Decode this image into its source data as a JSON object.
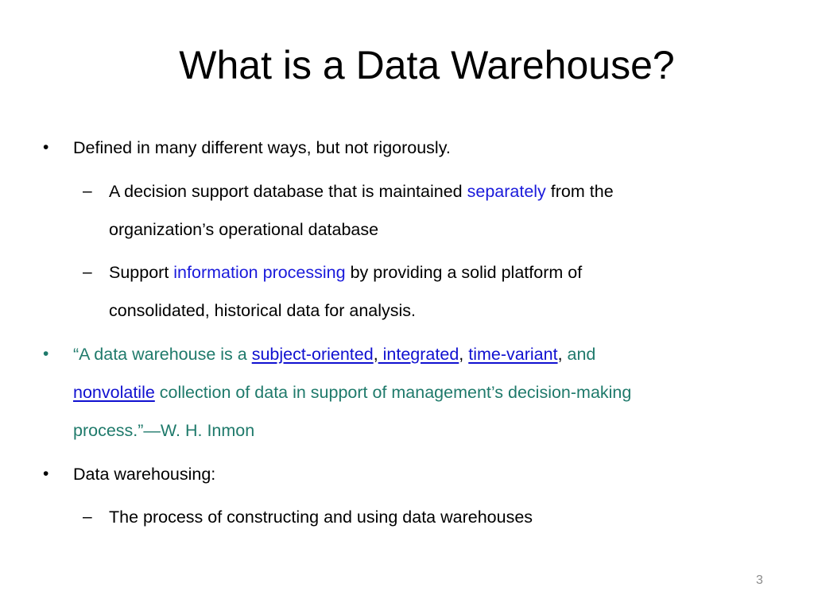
{
  "slide": {
    "title": "What is a Data Warehouse?",
    "page_number": "3",
    "bullets": {
      "b1": {
        "marker": "•",
        "text": "Defined in many different ways, but not rigorously."
      },
      "b1_sub1": {
        "marker": "–",
        "part1": "A decision support database that is maintained ",
        "highlight": "separately",
        "part2": " from the",
        "line2": "organization’s operational database"
      },
      "b1_sub2": {
        "marker": "–",
        "part1": "Support ",
        "highlight": "information processing",
        "part2": " by providing a solid platform of",
        "line2": "consolidated, historical data for analysis."
      },
      "b2": {
        "marker": "•",
        "quote_open": "“A data warehouse is a ",
        "link1": "subject-oriented",
        "comma1": ",",
        "link2": " integrated",
        "comma2": ",",
        "space": " ",
        "link3": "time-variant",
        "comma3": ",",
        "and": " and",
        "link4": "nonvolatile",
        "line2_rest": " collection of data in support of management’s decision-making",
        "line3": "process.”—W. H. Inmon"
      },
      "b3": {
        "marker": "•",
        "text": "Data warehousing:"
      },
      "b3_sub1": {
        "marker": "–",
        "text": "The process of constructing and using data warehouses"
      }
    },
    "colors": {
      "highlight_blue": "#1a1adb",
      "quote_teal": "#1f7a6b",
      "link_blue": "#1010d0",
      "page_number_gray": "#8c8c8c"
    }
  }
}
